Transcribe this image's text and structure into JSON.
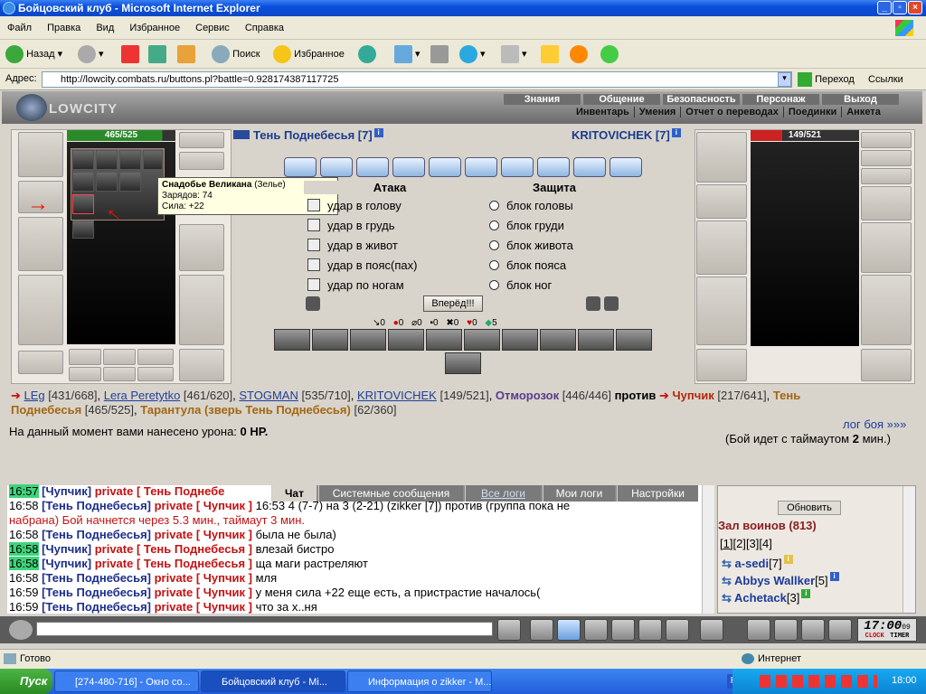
{
  "window": {
    "title": "Бойцовский клуб - Microsoft Internet Explorer"
  },
  "menu": [
    "Файл",
    "Правка",
    "Вид",
    "Избранное",
    "Сервис",
    "Справка"
  ],
  "toolbar": {
    "back": "Назад",
    "search": "Поиск",
    "favorites": "Избранное"
  },
  "address": {
    "label": "Адрес:",
    "url": "http://lowcity.combats.ru/buttons.pl?battle=0.928174387117725",
    "go": "Переход",
    "links": "Ссылки"
  },
  "game": {
    "logo": "LOWCITY",
    "nav_top": [
      "Знания",
      "Общение",
      "Безопасность",
      "Персонаж",
      "Выход"
    ],
    "nav_bottom": [
      "Инвентарь",
      "Умения",
      "Отчет о переводах",
      "Поединки",
      "Анкета"
    ],
    "left_hp": "465/525",
    "right_hp": "149/521",
    "fighter_left": "Тень Поднебесья [7]",
    "fighter_right": "KRITOVICHEK [7]",
    "attack_header": "Атака",
    "defense_header": "Защита",
    "attacks": [
      "удар в голову",
      "удар в грудь",
      "удар в живот",
      "удар в пояс(пах)",
      "удар по ногам"
    ],
    "blocks": [
      "блок головы",
      "блок груди",
      "блок живота",
      "блок пояса",
      "блок ног"
    ],
    "forward_button": "Вперёд!!!",
    "stats": [
      "0",
      "0",
      "0",
      "0",
      "0",
      "0",
      "5"
    ],
    "tooltip": {
      "title": "Снадобье Великана",
      "type": "(Зелье)",
      "charges": "Зарядов: 74",
      "power": "Сила: +22"
    },
    "team_line1": [
      {
        "name": "LEg",
        "hp": "[431/668]"
      },
      {
        "name": "Lera Peretytko",
        "hp": "[461/620]"
      },
      {
        "name": "STOGMAN",
        "hp": "[535/710]"
      },
      {
        "name": "KRITOVICHEK",
        "hp": "[149/521]"
      },
      {
        "name": "Отморозок",
        "hp": "[446/446]"
      }
    ],
    "versus": "против",
    "enemy1": {
      "name": "Чупчик",
      "hp": "[217/641]"
    },
    "enemy2_start": "Тень",
    "enemy2_end": "Поднебесья",
    "enemy2_hp": "[465/525]",
    "beast": "Тарантула (зверь Тень Поднебесья)",
    "beast_hp": "[62/360]",
    "damage_label": "На данный момент вами нанесено урона:",
    "damage_value": "0 HP.",
    "log_link": "лог боя »»»",
    "timeout_pre": "(Бой идет с таймаутом",
    "timeout_value": "2",
    "timeout_post": "мин.)"
  },
  "chat": {
    "tabs": [
      "Чат",
      "Системные сообщения",
      "Все логи",
      "Мои логи",
      "Настройки"
    ],
    "lines": [
      {
        "time": "16:57",
        "hl": true,
        "nick": "[Чупчик]",
        "priv": "private [ Тень Поднебе",
        "msg": ""
      },
      {
        "time": "16:58",
        "hl": false,
        "nick": "[Тень Поднебесья]",
        "priv": "private [ Чупчик ]",
        "msg": " 16:53 4 (7-7) на 3 (2-21) (zikker [7]) против (группа пока не"
      },
      {
        "time": "",
        "hl": false,
        "nick": "",
        "priv": "",
        "msg": "набрана) Бой начнется через 5.3 мин., таймаут 3 мин.",
        "sys": true
      },
      {
        "time": "16:58",
        "hl": false,
        "nick": "[Тень Поднебесья]",
        "priv": "private [ Чупчик ]",
        "msg": " была не была)"
      },
      {
        "time": "16:58",
        "hl": true,
        "nick": "[Чупчик]",
        "priv": "private [ Тень Поднебесья ]",
        "msg": " влезай бистро"
      },
      {
        "time": "16:58",
        "hl": true,
        "nick": "[Чупчик]",
        "priv": "private [ Тень Поднебесья ]",
        "msg": " ща маги растреляют"
      },
      {
        "time": "16:58",
        "hl": false,
        "nick": "[Тень Поднебесья]",
        "priv": "private [ Чупчик ]",
        "msg": " мля"
      },
      {
        "time": "16:59",
        "hl": false,
        "nick": "[Тень Поднебесья]",
        "priv": "private [ Чупчик ]",
        "msg": " у меня сила +22 еще есть, а пристрастие началось("
      },
      {
        "time": "16:59",
        "hl": false,
        "nick": "[Тень Поднебесья]",
        "priv": "private [ Чупчик ]",
        "msg": " что за х..ня"
      }
    ],
    "refresh": "Обновить",
    "hall": "Зал воинов (813)",
    "pages": [
      "[1]",
      "[2]",
      "[3]",
      "[4]"
    ],
    "users": [
      {
        "name": "a-sedi",
        "lvl": "[7]"
      },
      {
        "name": "Abbys Wallker",
        "lvl": "[5]"
      },
      {
        "name": "Achetack",
        "lvl": "[3]"
      }
    ],
    "clock": "17:00",
    "clock_sec": "09",
    "clock_label": "CLOCK",
    "timer_label": "TIMER"
  },
  "status": {
    "ready": "Готово",
    "zone": "Интернет"
  },
  "taskbar": {
    "start": "Пуск",
    "tasks": [
      "[274-480-716] - Окно со...",
      "Бойцовский клуб - Mi...",
      "Информация о zikker - M..."
    ],
    "lang": "RU",
    "time": "18:00"
  }
}
